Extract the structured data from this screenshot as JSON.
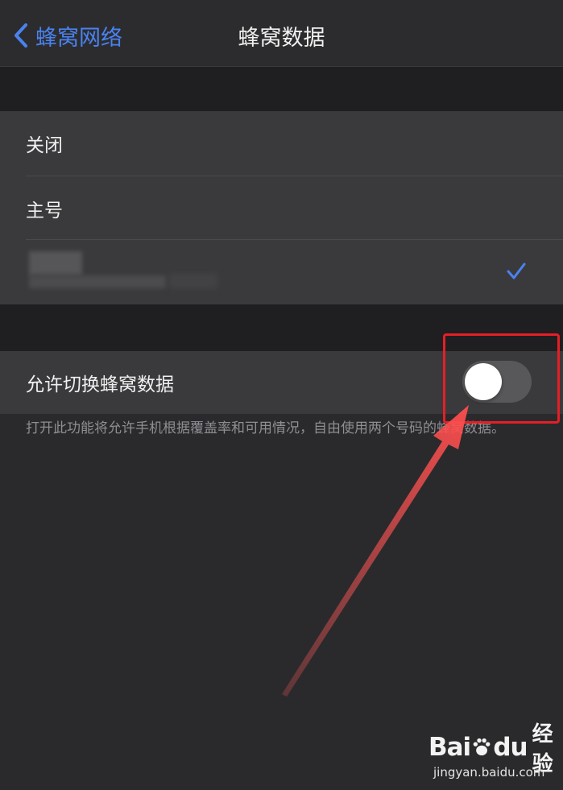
{
  "nav": {
    "back_label": "蜂窝网络",
    "title": "蜂窝数据"
  },
  "options": [
    {
      "label": "关闭",
      "selected": false
    },
    {
      "label": "主号",
      "selected": false
    },
    {
      "label": "",
      "selected": true
    }
  ],
  "switch_row": {
    "label": "允许切换蜂窝数据",
    "enabled": false
  },
  "footer": {
    "note": "打开此功能将允许手机根据覆盖率和可用情况，自由使用两个号码的蜂窝数据。"
  },
  "colors": {
    "accent": "#4a82f0",
    "annotation": "#e61e26"
  },
  "watermark": {
    "logo_left": "Bai",
    "logo_right": "du",
    "logo_cn": "经验",
    "url": "jingyan.baidu.com"
  }
}
